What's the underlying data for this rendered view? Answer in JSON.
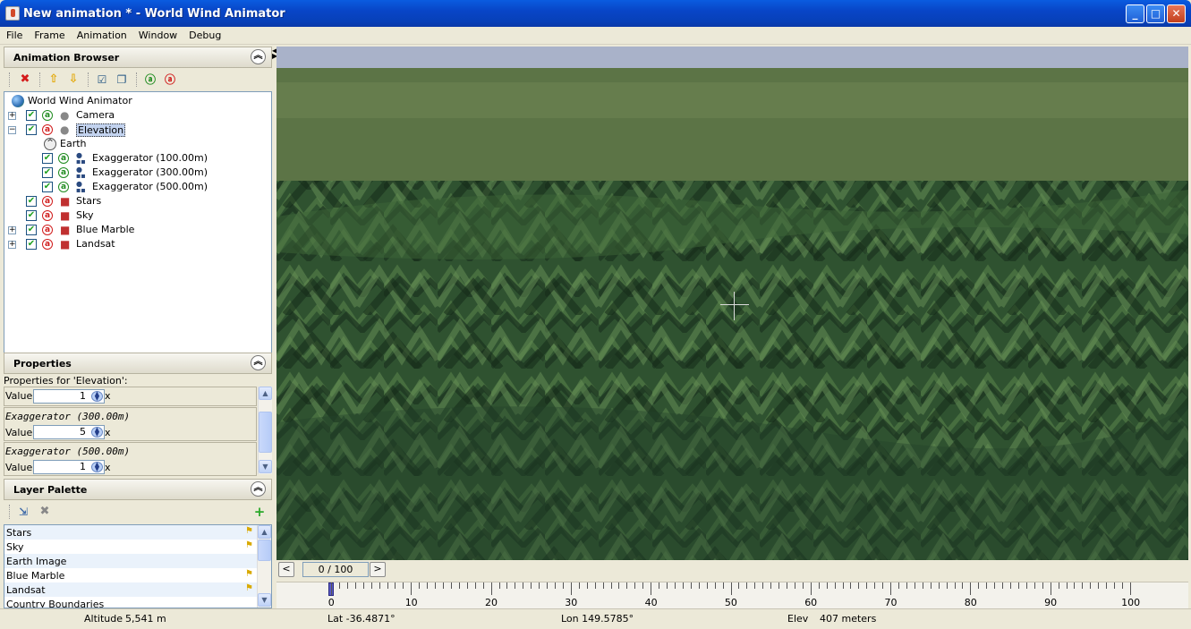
{
  "window": {
    "title": "New animation * - World Wind Animator",
    "minimize_label": "_",
    "maximize_label": "□",
    "close_label": "✕"
  },
  "menu": [
    "File",
    "Frame",
    "Animation",
    "Window",
    "Debug"
  ],
  "animation_browser": {
    "title": "Animation Browser",
    "toolbar_icons": [
      "delete-icon",
      "move-up-icon",
      "move-down-icon",
      "check-all-icon",
      "uncheck-all-icon",
      "animate-on-icon",
      "animate-off-icon"
    ],
    "tree": {
      "root": "World Wind Animator",
      "items": [
        {
          "label": "Camera"
        },
        {
          "label": "Elevation"
        },
        {
          "label": "Earth"
        },
        {
          "label": "Exaggerator (100.00m)"
        },
        {
          "label": "Exaggerator (300.00m)"
        },
        {
          "label": "Exaggerator (500.00m)"
        },
        {
          "label": "Stars"
        },
        {
          "label": "Sky"
        },
        {
          "label": "Blue Marble"
        },
        {
          "label": "Landsat"
        }
      ]
    }
  },
  "properties": {
    "title": "Properties",
    "heading": "Properties for 'Elevation':",
    "groups": [
      {
        "name": "",
        "value_label": "Value:",
        "value": "1",
        "unit": "x"
      },
      {
        "name": "Exaggerator (300.00m)",
        "value_label": "Value:",
        "value": "5",
        "unit": "x"
      },
      {
        "name": "Exaggerator (500.00m)",
        "value_label": "Value:",
        "value": "1",
        "unit": "x"
      }
    ]
  },
  "layer_palette": {
    "title": "Layer Palette",
    "items": [
      "Stars",
      "Sky",
      "Earth Image",
      "Blue Marble",
      "Landsat",
      "Country Boundaries"
    ]
  },
  "timeline": {
    "frame_display": "0 / 100",
    "prev_label": "<",
    "next_label": ">",
    "ruler_labels": [
      "0",
      "10",
      "20",
      "30",
      "40",
      "50",
      "60",
      "70",
      "80",
      "90",
      "100"
    ],
    "current_frame": 0
  },
  "status": {
    "altitude_label": "Altitude",
    "altitude_value": "5,541 m",
    "lat": "Lat -36.4871°",
    "lon": "Lon 149.5785°",
    "elev_label": "Elev",
    "elev_value": "407 meters"
  }
}
